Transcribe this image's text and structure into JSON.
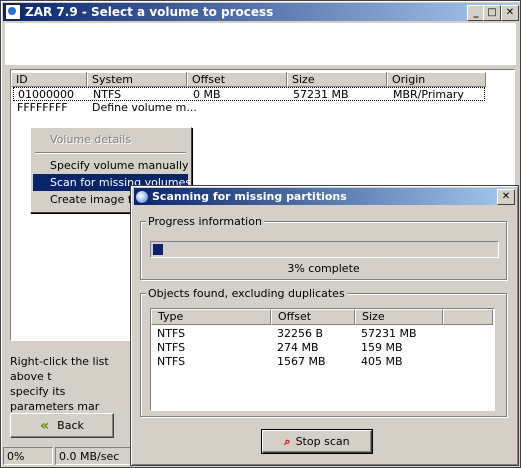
{
  "window": {
    "title": "ZAR 7.9 - Select a volume to process"
  },
  "volume_list": {
    "columns": [
      "ID",
      "System",
      "Offset",
      "Size",
      "Origin"
    ],
    "rows": [
      {
        "id": "01000000",
        "system": "NTFS",
        "offset": "0 MB",
        "size": "57231 MB",
        "origin": "MBR/Primary"
      },
      {
        "id": "FFFFFFFF",
        "system": "Define volume m..."
      }
    ]
  },
  "hint": {
    "line1": "Right-click the list above t",
    "line2": "specify its parameters mar"
  },
  "context_menu": {
    "items": [
      {
        "label": "Volume details"
      },
      {
        "label": "Specify volume manually"
      },
      {
        "label": "Scan for missing volumes"
      },
      {
        "label": "Create image file"
      }
    ]
  },
  "back_label": "Back",
  "status": {
    "percent": "0%",
    "speed": "0.0 MB/sec"
  },
  "dialog": {
    "title": "Scanning for missing partitions",
    "progress_group": "Progress information",
    "progress_value": 3,
    "progress_text": "3% complete",
    "objects_group": "Objects found, excluding duplicates",
    "columns": [
      "Type",
      "Offset",
      "Size"
    ],
    "rows": [
      {
        "type": "NTFS",
        "offset": "32256 B",
        "size": "57231 MB"
      },
      {
        "type": "NTFS",
        "offset": "274 MB",
        "size": "159 MB"
      },
      {
        "type": "NTFS",
        "offset": "1567 MB",
        "size": "405 MB"
      }
    ],
    "stop_label": "Stop scan"
  }
}
